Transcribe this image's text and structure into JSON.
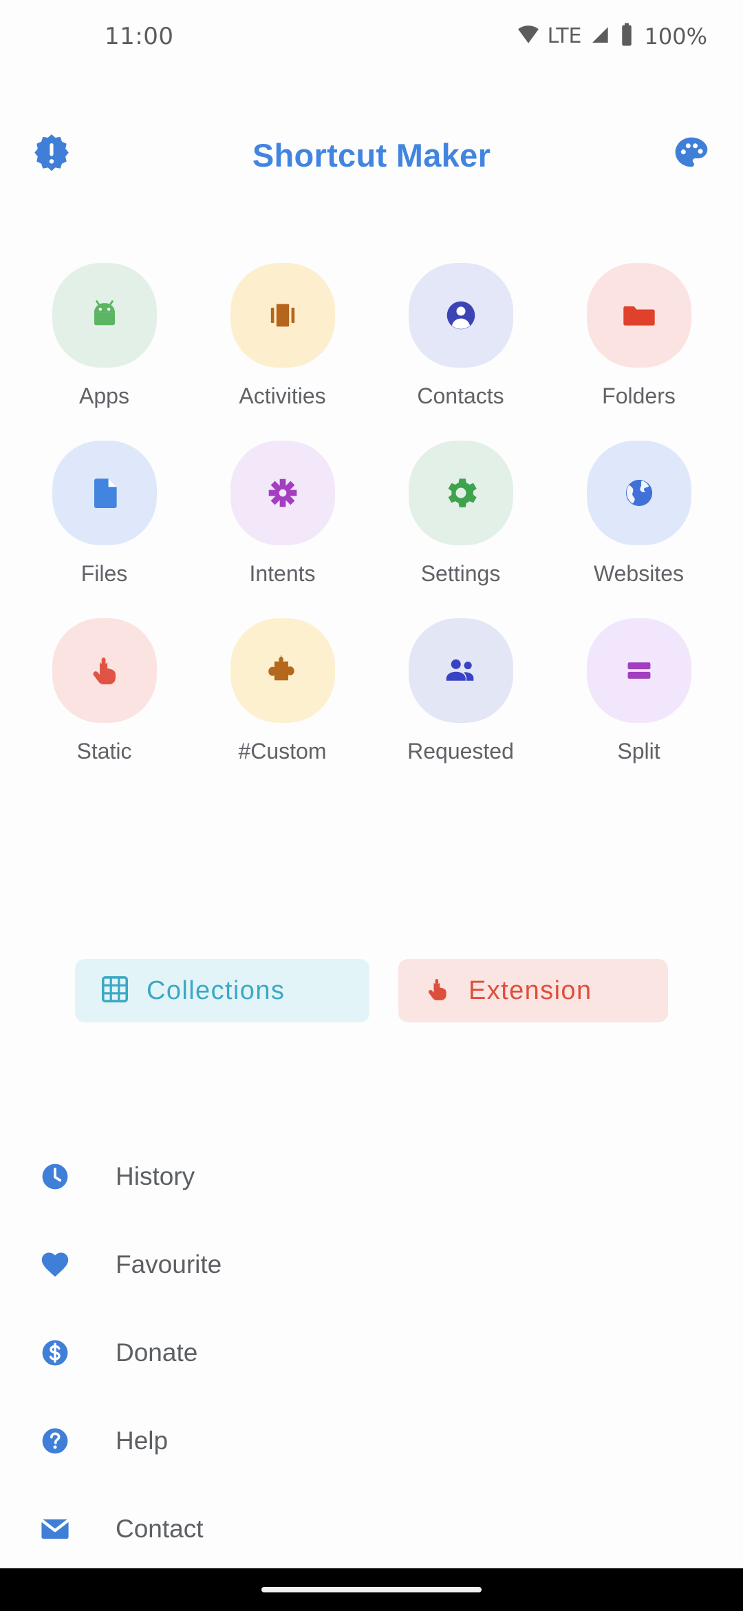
{
  "status_bar": {
    "time": "11:00",
    "network_label": "LTE",
    "battery_percent": "100%",
    "icons": [
      "wifi-icon",
      "cellular-signal-icon",
      "battery-icon"
    ]
  },
  "app_bar": {
    "title": "Shortcut Maker",
    "title_color": "#4285e0",
    "left_icon": "alert-badge-icon",
    "right_icon": "palette-icon"
  },
  "grid": {
    "items": [
      {
        "label": "Apps",
        "icon": "android-robot-icon",
        "bg": "#e3f0e7",
        "fg": "#5bb563"
      },
      {
        "label": "Activities",
        "icon": "activity-window-icon",
        "bg": "#fdeecd",
        "fg": "#b5651c"
      },
      {
        "label": "Contacts",
        "icon": "person-circle-icon",
        "bg": "#e4e7f7",
        "fg": "#3b43b5"
      },
      {
        "label": "Folders",
        "icon": "folder-icon",
        "bg": "#fbe3e1",
        "fg": "#e0412c"
      },
      {
        "label": "Files",
        "icon": "document-icon",
        "bg": "#dfe8fb",
        "fg": "#4285e0"
      },
      {
        "label": "Intents",
        "icon": "intent-cross-icon",
        "bg": "#f3e7fa",
        "fg": "#a33fbf"
      },
      {
        "label": "Settings",
        "icon": "gear-icon",
        "bg": "#e3f0e7",
        "fg": "#3fa34d"
      },
      {
        "label": "Websites",
        "icon": "globe-icon",
        "bg": "#dfe8fb",
        "fg": "#3f71d8"
      },
      {
        "label": "Static",
        "icon": "touch-hand-icon",
        "bg": "#fbe3e1",
        "fg": "#e05444"
      },
      {
        "label": "#Custom",
        "icon": "puzzle-piece-icon",
        "bg": "#fcf0cf",
        "fg": "#b5681c"
      },
      {
        "label": "Requested",
        "icon": "people-icon",
        "bg": "#e3e6f5",
        "fg": "#3942c4"
      },
      {
        "label": "Split",
        "icon": "split-bars-icon",
        "bg": "#f1e6fb",
        "fg": "#a23fc0"
      }
    ]
  },
  "actions": [
    {
      "label": "Collections",
      "icon": "grid-table-icon",
      "bg": "#e3f4f8",
      "fg": "#3ba8c4"
    },
    {
      "label": "Extension",
      "icon": "touch-hand-icon",
      "bg": "#fae5e2",
      "fg": "#dd4f3c"
    }
  ],
  "menu": {
    "items": [
      {
        "label": "History",
        "icon": "clock-icon",
        "color": "#3f7fd8"
      },
      {
        "label": "Favourite",
        "icon": "heart-icon",
        "color": "#3f7fd8"
      },
      {
        "label": "Donate",
        "icon": "dollar-icon",
        "color": "#3f7fd8"
      },
      {
        "label": "Help",
        "icon": "question-icon",
        "color": "#3f7fd8"
      },
      {
        "label": "Contact",
        "icon": "envelope-icon",
        "color": "#3f7fd8"
      }
    ]
  },
  "nav_bar": {
    "gesture_pill": "home-gesture-pill"
  }
}
